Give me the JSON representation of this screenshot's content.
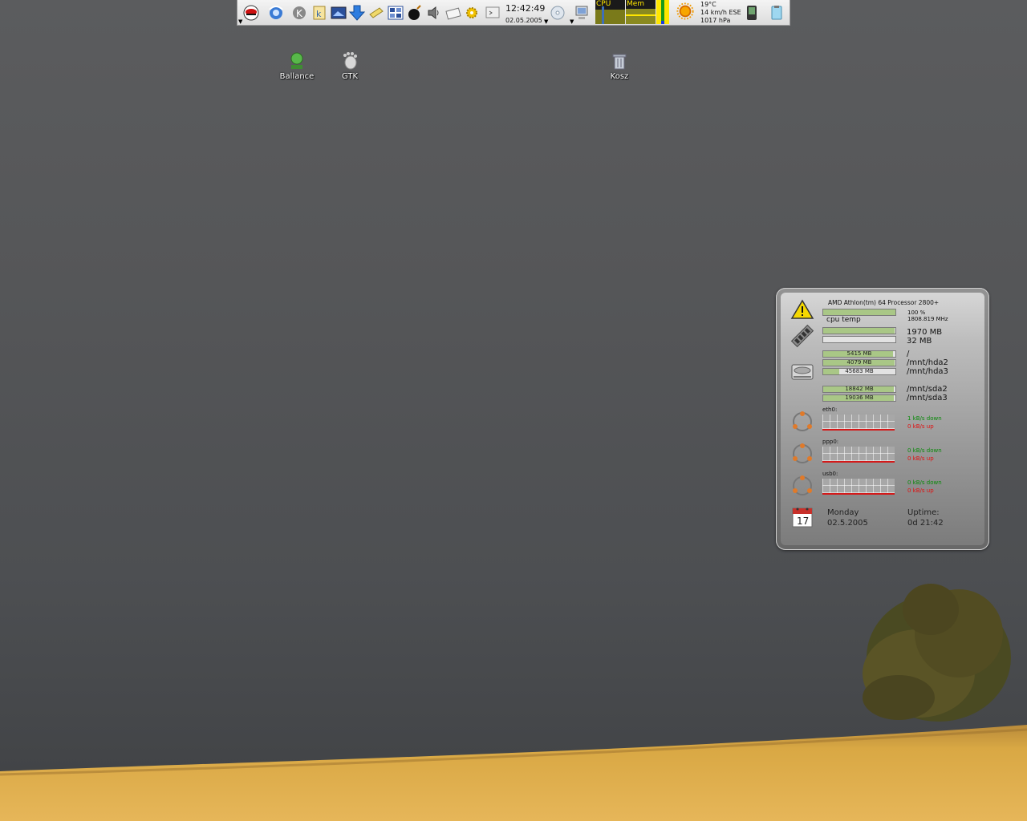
{
  "taskbar": {
    "clock_time": "12:42:49",
    "clock_date": "02.05.2005",
    "cpu_label": "CPU",
    "mem_label": "Mem",
    "weather": {
      "temperature": "19°C",
      "wind": "14 km/h ESE",
      "pressure": "1017 hPa"
    },
    "icons": [
      "redhat-menu-icon",
      "konqueror-icon",
      "k-icon",
      "konqueror-k-icon",
      "screenshot-icon",
      "download-arrow-icon",
      "notes-icon",
      "desktop-pager-icon",
      "bomb-icon",
      "speaker-icon",
      "mail-icon",
      "settings-gear-icon",
      "terminal-icon",
      "cd-icon",
      "computer-icon",
      "weather-sun-icon",
      "pda-icon",
      "clipboard-icon"
    ]
  },
  "desktop": {
    "icons": [
      {
        "label": "Ballance"
      },
      {
        "label": "GTK"
      },
      {
        "label": "Kosz"
      }
    ]
  },
  "sysmon": {
    "cpu_name": "AMD Athlon(tm) 64 Processor 2800+",
    "cpu_temp_label": "cpu temp",
    "cpu_load": "100 %",
    "cpu_freq": "1808.819 MHz",
    "cpu_load_fraction": 1.0,
    "ram_total": "1970 MB",
    "swap_total": "32 MB",
    "ram_fraction": 0.99,
    "disks": [
      {
        "used": "5415 MB",
        "mount": "/",
        "fraction": 0.97
      },
      {
        "used": "4079 MB",
        "mount": "/mnt/hda2",
        "fraction": 0.99
      },
      {
        "used": "45683 MB",
        "mount": "/mnt/hda3",
        "fraction": 0.22
      },
      {
        "used": "18842 MB",
        "mount": "/mnt/sda2",
        "fraction": 0.98
      },
      {
        "used": "19036 MB",
        "mount": "/mnt/sda3",
        "fraction": 0.98
      }
    ],
    "net": [
      {
        "iface": "eth0:",
        "down": "1 kB/s down",
        "up": "0 kB/s up"
      },
      {
        "iface": "ppp0:",
        "down": "0 kB/s down",
        "up": "0 kB/s up"
      },
      {
        "iface": "usb0:",
        "down": "0 kB/s down",
        "up": "0 kB/s up"
      }
    ],
    "calendar_day": "17",
    "weekday": "Monday",
    "date": "02.5.2005",
    "uptime_label": "Uptime:",
    "uptime_value": "0d 21:42"
  },
  "colors": {
    "panel_bg": "#e8e8e8",
    "bar_fill": "#a9c786",
    "net_down": "#0a8a0a",
    "net_up": "#e01010",
    "monitor_label": "#ffe600",
    "field": "#d7a53e"
  }
}
